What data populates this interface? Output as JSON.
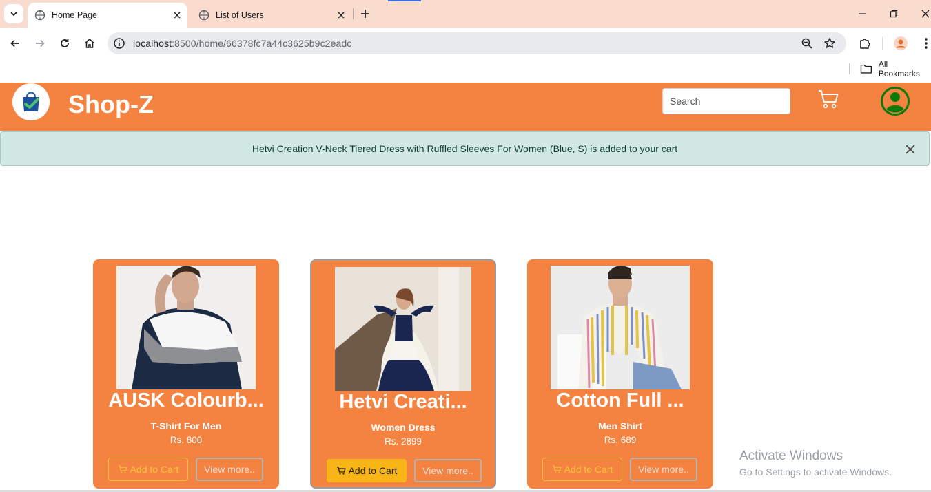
{
  "browser": {
    "tabs": [
      {
        "title": "Home Page",
        "active": true
      },
      {
        "title": "List of Users",
        "active": false
      }
    ],
    "url_host": "localhost",
    "url_path": ":8500/home/66378fc7a44c3625b9c2eadc",
    "bookmarks_label": "All Bookmarks"
  },
  "header": {
    "brand": "Shop-Z",
    "search_placeholder": "Search",
    "accent_color": "#f48240"
  },
  "alert": {
    "message": "Hetvi Creation V-Neck Tiered Dress with Ruffled Sleeves For Women (Blue, S) is added to your cart"
  },
  "products": [
    {
      "name": "AUSK Colourb...",
      "category": "T-Shirt For Men",
      "price": "Rs. 800",
      "add_label": "Add to Cart",
      "more_label": "View more.."
    },
    {
      "name": "Hetvi Creati...",
      "category": "Women Dress",
      "price": "Rs. 2899",
      "add_label": "Add to Cart",
      "more_label": "View more.."
    },
    {
      "name": "Cotton Full ...",
      "category": "Men Shirt",
      "price": "Rs. 689",
      "add_label": "Add to Cart",
      "more_label": "View more.."
    }
  ],
  "watermark": {
    "line1": "Activate Windows",
    "line2": "Go to Settings to activate Windows."
  }
}
